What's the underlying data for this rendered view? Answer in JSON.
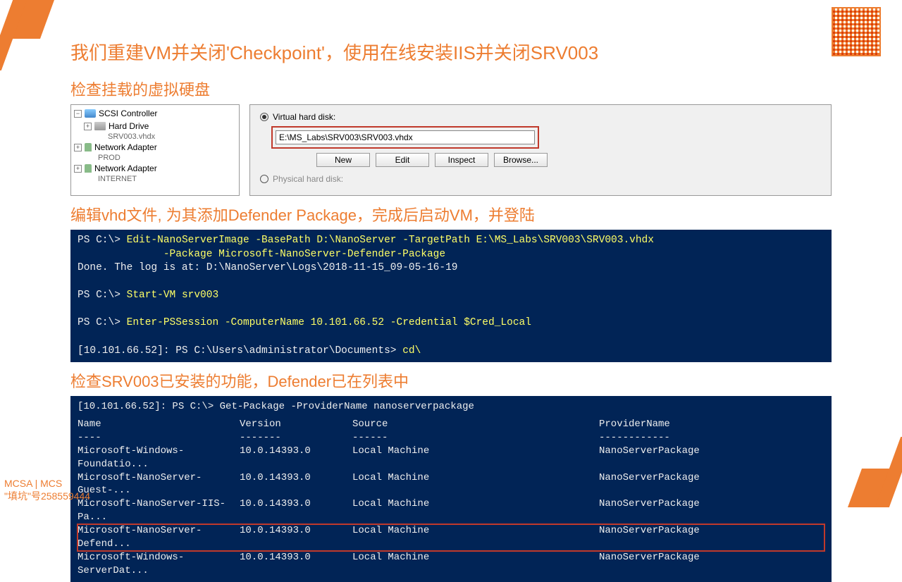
{
  "title": "我们重建VM并关闭'Checkpoint'，使用在线安装IIS并关闭SRV003",
  "section1": "检查挂载的虚拟硬盘",
  "tree": {
    "scsi": "SCSI Controller",
    "hdd": "Hard Drive",
    "hdd_sub": "SRV003.vhdx",
    "net1": "Network Adapter",
    "net1_sub": "PROD",
    "net2": "Network Adapter",
    "net2_sub": "INTERNET"
  },
  "vhd": {
    "opt1": "Virtual hard disk:",
    "path": "E:\\MS_Labs\\SRV003\\SRV003.vhdx",
    "btn_new": "New",
    "btn_edit": "Edit",
    "btn_inspect": "Inspect",
    "btn_browse": "Browse...",
    "opt2": "Physical hard disk:"
  },
  "section2": "编辑vhd文件, 为其添加Defender Package，完成后启动VM，并登陆",
  "ps1": {
    "l1a": "PS C:\\> ",
    "l1b": "Edit-NanoServerImage -BasePath D:\\NanoServer -TargetPath E:\\MS_Labs\\SRV003\\SRV003.vhdx",
    "l2": "              -Package Microsoft-NanoServer-Defender-Package",
    "l3": "Done. The log is at: D:\\NanoServer\\Logs\\2018-11-15_09-05-16-19",
    "l4a": "PS C:\\> ",
    "l4b": "Start-VM srv003",
    "l5a": "PS C:\\> ",
    "l5b": "Enter-PSSession -ComputerName 10.101.66.52 -Credential $Cred_Local",
    "l6a": "[10.101.66.52]: PS C:\\Users\\administrator\\Documents> ",
    "l6b": "cd\\"
  },
  "section3": "检查SRV003已安装的功能，Defender已在列表中",
  "ps2": {
    "prompt": "[10.101.66.52]: PS C:\\> ",
    "cmd": "Get-Package -ProviderName nanoserverpackage",
    "h1": "Name",
    "h2": "Version",
    "h3": "Source",
    "h4": "ProviderName",
    "d1": "----",
    "d2": "-------",
    "d3": "------",
    "d4": "------------",
    "rows": [
      {
        "n": "Microsoft-Windows-Foundatio...",
        "v": "10.0.14393.0",
        "s": "Local Machine",
        "p": "NanoServerPackage"
      },
      {
        "n": "Microsoft-NanoServer-Guest-...",
        "v": "10.0.14393.0",
        "s": "Local Machine",
        "p": "NanoServerPackage"
      },
      {
        "n": "Microsoft-NanoServer-IIS-Pa...",
        "v": "10.0.14393.0",
        "s": "Local Machine",
        "p": "NanoServerPackage"
      },
      {
        "n": "Microsoft-NanoServer-Defend...",
        "v": "10.0.14393.0",
        "s": "Local Machine",
        "p": "NanoServerPackage"
      },
      {
        "n": "Microsoft-Windows-ServerDat...",
        "v": "10.0.14393.0",
        "s": "Local Machine",
        "p": "NanoServerPackage"
      }
    ]
  },
  "footer": {
    "l1": "MCSA | MCS",
    "l2": "\"填坑\"号258559444"
  }
}
